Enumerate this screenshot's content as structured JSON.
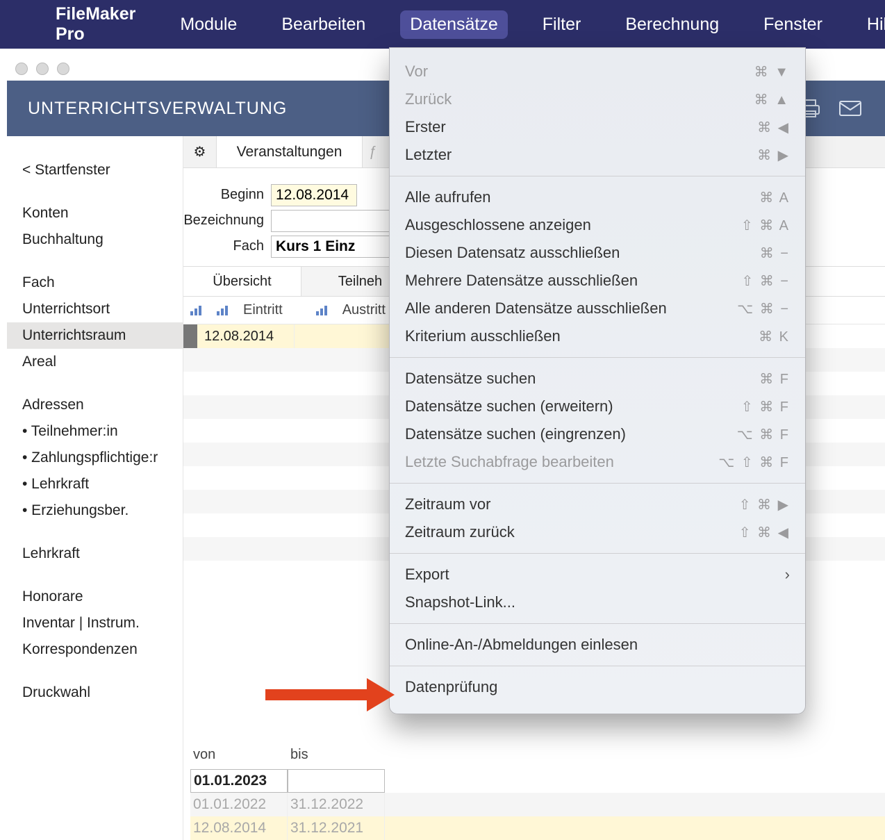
{
  "menubar": {
    "app": "FileMaker Pro",
    "items": [
      "Module",
      "Bearbeiten",
      "Datensätze",
      "Filter",
      "Berechnung",
      "Fenster",
      "Hilfe"
    ],
    "active_index": 2
  },
  "appheader": {
    "title": "UNTERRICHTSVERWALTUNG"
  },
  "sidebar": {
    "back": "< Startfenster",
    "group1": [
      "Konten",
      "Buchhaltung"
    ],
    "group2": [
      "Fach",
      "Unterrichtsort",
      "Unterrichtsraum",
      "Areal"
    ],
    "selected": "Unterrichtsraum",
    "addr_head": "Adressen",
    "addr": [
      "• Teilnehmer:in",
      "• Zahlungspflichtige:r",
      "• Lehrkraft",
      "• Erziehungsber."
    ],
    "group3": [
      "Lehrkraft"
    ],
    "group4": [
      "Honorare",
      "Inventar | Instrum.",
      "Korrespondenzen"
    ],
    "group5": [
      "Druckwahl"
    ]
  },
  "tabs1": {
    "gear": "⚙︎",
    "tab1": "Veranstaltungen",
    "ghost": "ƒ"
  },
  "form": {
    "label_beginn": "Beginn",
    "beginn_value": "12.08.2014",
    "label_bez": "Bezeichnung",
    "bez_value": "",
    "label_fach": "Fach",
    "fach_value": "Kurs 1 Einz"
  },
  "tabs2": {
    "t1": "Übersicht",
    "t2": "Teilneh"
  },
  "grid": {
    "h1": "Eintritt",
    "h2": "Austritt",
    "row1_eintritt": "12.08.2014"
  },
  "periods": {
    "h_von": "von",
    "h_bis": "bis",
    "rows": [
      {
        "von": "01.01.2023",
        "bis": ""
      },
      {
        "von": "01.01.2022",
        "bis": "31.12.2022"
      },
      {
        "von": "12.08.2014",
        "bis": "31.12.2021"
      }
    ]
  },
  "menu": {
    "items": [
      {
        "label": "Vor",
        "shortcut": "⌘ ▼",
        "disabled": true
      },
      {
        "label": "Zurück",
        "shortcut": "⌘ ▲",
        "disabled": true
      },
      {
        "label": "Erster",
        "shortcut": "⌘ ◀",
        "disabled": false
      },
      {
        "label": "Letzter",
        "shortcut": "⌘ ▶",
        "disabled": false
      },
      {
        "sep": true
      },
      {
        "label": "Alle aufrufen",
        "shortcut": "⌘ A",
        "disabled": false
      },
      {
        "label": "Ausgeschlossene anzeigen",
        "shortcut": "⇧ ⌘ A",
        "disabled": false
      },
      {
        "label": "Diesen Datensatz ausschließen",
        "shortcut": "⌘ −",
        "disabled": false
      },
      {
        "label": "Mehrere Datensätze ausschließen",
        "shortcut": "⇧ ⌘ −",
        "disabled": false
      },
      {
        "label": "Alle anderen Datensätze ausschließen",
        "shortcut": "⌥ ⌘ −",
        "disabled": false
      },
      {
        "label": "Kriterium ausschließen",
        "shortcut": "⌘ K",
        "disabled": false
      },
      {
        "sep": true
      },
      {
        "label": "Datensätze suchen",
        "shortcut": "⌘ F",
        "disabled": false
      },
      {
        "label": "Datensätze suchen (erweitern)",
        "shortcut": "⇧ ⌘ F",
        "disabled": false
      },
      {
        "label": "Datensätze suchen (eingrenzen)",
        "shortcut": "⌥ ⌘ F",
        "disabled": false
      },
      {
        "label": "Letzte Suchabfrage bearbeiten",
        "shortcut": "⌥ ⇧ ⌘ F",
        "disabled": true
      },
      {
        "sep": true
      },
      {
        "label": "Zeitraum vor",
        "shortcut": "⇧ ⌘ ▶",
        "disabled": false
      },
      {
        "label": "Zeitraum zurück",
        "shortcut": "⇧ ⌘ ◀",
        "disabled": false
      },
      {
        "sep": true
      },
      {
        "label": "Export",
        "submenu": true,
        "disabled": false
      },
      {
        "label": "Snapshot-Link...",
        "disabled": false
      },
      {
        "sep": true
      },
      {
        "label": "Online-An-/Abmeldungen einlesen",
        "disabled": false
      },
      {
        "sep": true
      },
      {
        "label": "Datenprüfung",
        "disabled": false
      }
    ]
  }
}
